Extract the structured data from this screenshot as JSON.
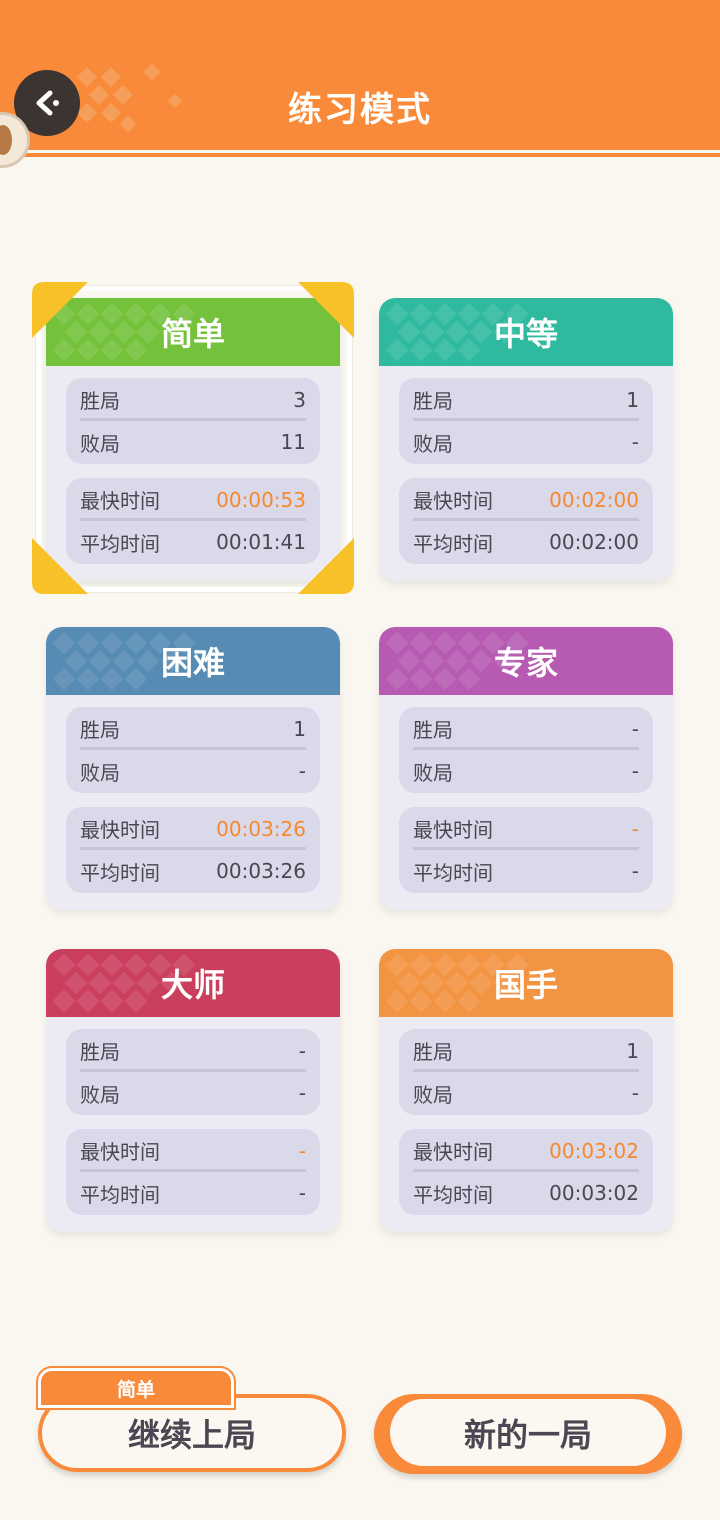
{
  "header": {
    "title": "练习模式",
    "color": "#f98a3a",
    "back_icon": "back-arrow-icon"
  },
  "labels": {
    "wins": "胜局",
    "losses": "败局",
    "fastest": "最快时间",
    "average": "平均时间"
  },
  "cards": [
    {
      "name": "简单",
      "color": "#74c23c",
      "wins": "3",
      "losses": "11",
      "fastest": "00:00:53",
      "average": "00:01:41",
      "selected": true
    },
    {
      "name": "中等",
      "color": "#2fba9f",
      "wins": "1",
      "losses": "-",
      "fastest": "00:02:00",
      "average": "00:02:00"
    },
    {
      "name": "困难",
      "color": "#568bb3",
      "wins": "1",
      "losses": "-",
      "fastest": "00:03:26",
      "average": "00:03:26"
    },
    {
      "name": "专家",
      "color": "#b65bb1",
      "wins": "-",
      "losses": "-",
      "fastest": "-",
      "average": "-"
    },
    {
      "name": "大师",
      "color": "#cb3f5e",
      "wins": "-",
      "losses": "-",
      "fastest": "-",
      "average": "-"
    },
    {
      "name": "国手",
      "color": "#f39442",
      "wins": "1",
      "losses": "-",
      "fastest": "00:03:02",
      "average": "00:03:02"
    }
  ],
  "bottom": {
    "continue_tag": "简单",
    "continue_label": "继续上局",
    "new_label": "新的一局"
  }
}
